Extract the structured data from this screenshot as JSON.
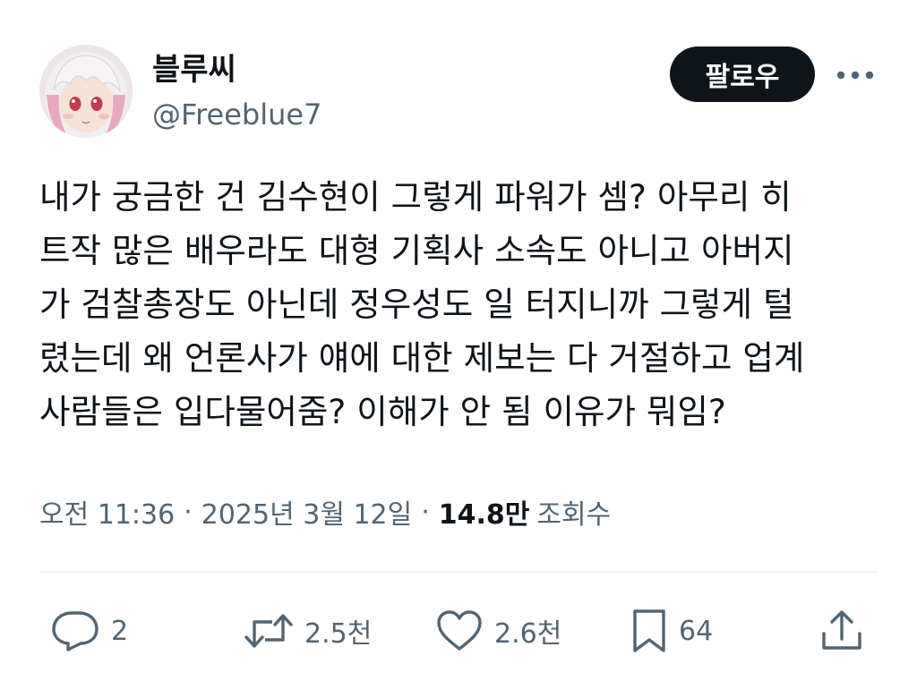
{
  "author": {
    "display_name": "블루씨",
    "handle": "@Freeblue7",
    "avatar_icon": "anime-avatar-icon"
  },
  "header": {
    "follow_label": "팔로우",
    "more_icon": "more-horizontal-icon"
  },
  "post": {
    "lines": [
      "내가 궁금한 건 김수현이 그렇게 파워가 셈? 아무리 히",
      "트작 많은 배우라도 대형 기획사 소속도 아니고 아버지",
      "가 검찰총장도 아닌데 정우성도 일 터지니까 그렇게 털",
      "렸는데 왜 언론사가 얘에 대한 제보는 다 거절하고 업계",
      "사람들은 입다물어줌? 이해가 안 됨 이유가 뭐임?"
    ]
  },
  "meta": {
    "time": "오전 11:36",
    "separator": "·",
    "date": "2025년 3월 12일",
    "views_count": "14.8만",
    "views_label": "조회수"
  },
  "actions": {
    "reply": {
      "icon": "reply-icon",
      "count": "2"
    },
    "repost": {
      "icon": "repost-icon",
      "count": "2.5천"
    },
    "like": {
      "icon": "heart-icon",
      "count": "2.6천"
    },
    "bookmark": {
      "icon": "bookmark-icon",
      "count": "64"
    },
    "share": {
      "icon": "share-icon"
    }
  },
  "colors": {
    "text_primary": "#0f1419",
    "text_secondary": "#536471",
    "divider": "#eff3f4",
    "follow_bg": "#0f1419",
    "follow_text": "#ffffff"
  }
}
